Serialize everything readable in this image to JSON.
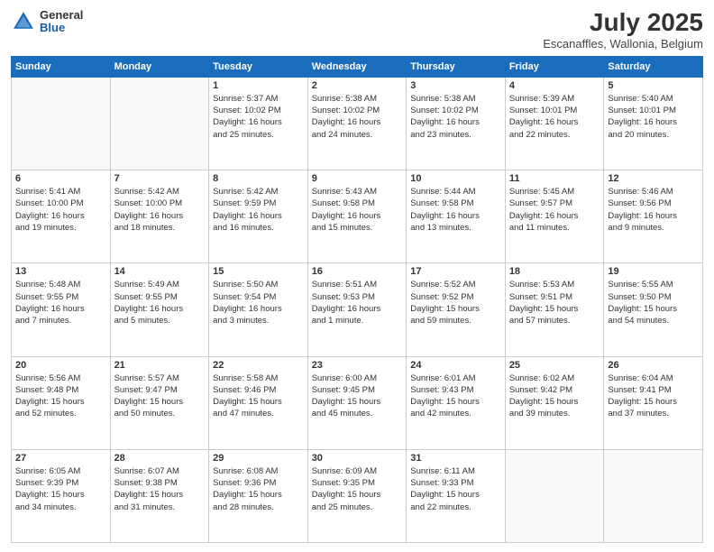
{
  "logo": {
    "general": "General",
    "blue": "Blue"
  },
  "header": {
    "title": "July 2025",
    "subtitle": "Escanaffles, Wallonia, Belgium"
  },
  "weekdays": [
    "Sunday",
    "Monday",
    "Tuesday",
    "Wednesday",
    "Thursday",
    "Friday",
    "Saturday"
  ],
  "weeks": [
    [
      {
        "day": "",
        "info": ""
      },
      {
        "day": "",
        "info": ""
      },
      {
        "day": "1",
        "info": "Sunrise: 5:37 AM\nSunset: 10:02 PM\nDaylight: 16 hours\nand 25 minutes."
      },
      {
        "day": "2",
        "info": "Sunrise: 5:38 AM\nSunset: 10:02 PM\nDaylight: 16 hours\nand 24 minutes."
      },
      {
        "day": "3",
        "info": "Sunrise: 5:38 AM\nSunset: 10:02 PM\nDaylight: 16 hours\nand 23 minutes."
      },
      {
        "day": "4",
        "info": "Sunrise: 5:39 AM\nSunset: 10:01 PM\nDaylight: 16 hours\nand 22 minutes."
      },
      {
        "day": "5",
        "info": "Sunrise: 5:40 AM\nSunset: 10:01 PM\nDaylight: 16 hours\nand 20 minutes."
      }
    ],
    [
      {
        "day": "6",
        "info": "Sunrise: 5:41 AM\nSunset: 10:00 PM\nDaylight: 16 hours\nand 19 minutes."
      },
      {
        "day": "7",
        "info": "Sunrise: 5:42 AM\nSunset: 10:00 PM\nDaylight: 16 hours\nand 18 minutes."
      },
      {
        "day": "8",
        "info": "Sunrise: 5:42 AM\nSunset: 9:59 PM\nDaylight: 16 hours\nand 16 minutes."
      },
      {
        "day": "9",
        "info": "Sunrise: 5:43 AM\nSunset: 9:58 PM\nDaylight: 16 hours\nand 15 minutes."
      },
      {
        "day": "10",
        "info": "Sunrise: 5:44 AM\nSunset: 9:58 PM\nDaylight: 16 hours\nand 13 minutes."
      },
      {
        "day": "11",
        "info": "Sunrise: 5:45 AM\nSunset: 9:57 PM\nDaylight: 16 hours\nand 11 minutes."
      },
      {
        "day": "12",
        "info": "Sunrise: 5:46 AM\nSunset: 9:56 PM\nDaylight: 16 hours\nand 9 minutes."
      }
    ],
    [
      {
        "day": "13",
        "info": "Sunrise: 5:48 AM\nSunset: 9:55 PM\nDaylight: 16 hours\nand 7 minutes."
      },
      {
        "day": "14",
        "info": "Sunrise: 5:49 AM\nSunset: 9:55 PM\nDaylight: 16 hours\nand 5 minutes."
      },
      {
        "day": "15",
        "info": "Sunrise: 5:50 AM\nSunset: 9:54 PM\nDaylight: 16 hours\nand 3 minutes."
      },
      {
        "day": "16",
        "info": "Sunrise: 5:51 AM\nSunset: 9:53 PM\nDaylight: 16 hours\nand 1 minute."
      },
      {
        "day": "17",
        "info": "Sunrise: 5:52 AM\nSunset: 9:52 PM\nDaylight: 15 hours\nand 59 minutes."
      },
      {
        "day": "18",
        "info": "Sunrise: 5:53 AM\nSunset: 9:51 PM\nDaylight: 15 hours\nand 57 minutes."
      },
      {
        "day": "19",
        "info": "Sunrise: 5:55 AM\nSunset: 9:50 PM\nDaylight: 15 hours\nand 54 minutes."
      }
    ],
    [
      {
        "day": "20",
        "info": "Sunrise: 5:56 AM\nSunset: 9:48 PM\nDaylight: 15 hours\nand 52 minutes."
      },
      {
        "day": "21",
        "info": "Sunrise: 5:57 AM\nSunset: 9:47 PM\nDaylight: 15 hours\nand 50 minutes."
      },
      {
        "day": "22",
        "info": "Sunrise: 5:58 AM\nSunset: 9:46 PM\nDaylight: 15 hours\nand 47 minutes."
      },
      {
        "day": "23",
        "info": "Sunrise: 6:00 AM\nSunset: 9:45 PM\nDaylight: 15 hours\nand 45 minutes."
      },
      {
        "day": "24",
        "info": "Sunrise: 6:01 AM\nSunset: 9:43 PM\nDaylight: 15 hours\nand 42 minutes."
      },
      {
        "day": "25",
        "info": "Sunrise: 6:02 AM\nSunset: 9:42 PM\nDaylight: 15 hours\nand 39 minutes."
      },
      {
        "day": "26",
        "info": "Sunrise: 6:04 AM\nSunset: 9:41 PM\nDaylight: 15 hours\nand 37 minutes."
      }
    ],
    [
      {
        "day": "27",
        "info": "Sunrise: 6:05 AM\nSunset: 9:39 PM\nDaylight: 15 hours\nand 34 minutes."
      },
      {
        "day": "28",
        "info": "Sunrise: 6:07 AM\nSunset: 9:38 PM\nDaylight: 15 hours\nand 31 minutes."
      },
      {
        "day": "29",
        "info": "Sunrise: 6:08 AM\nSunset: 9:36 PM\nDaylight: 15 hours\nand 28 minutes."
      },
      {
        "day": "30",
        "info": "Sunrise: 6:09 AM\nSunset: 9:35 PM\nDaylight: 15 hours\nand 25 minutes."
      },
      {
        "day": "31",
        "info": "Sunrise: 6:11 AM\nSunset: 9:33 PM\nDaylight: 15 hours\nand 22 minutes."
      },
      {
        "day": "",
        "info": ""
      },
      {
        "day": "",
        "info": ""
      }
    ]
  ]
}
